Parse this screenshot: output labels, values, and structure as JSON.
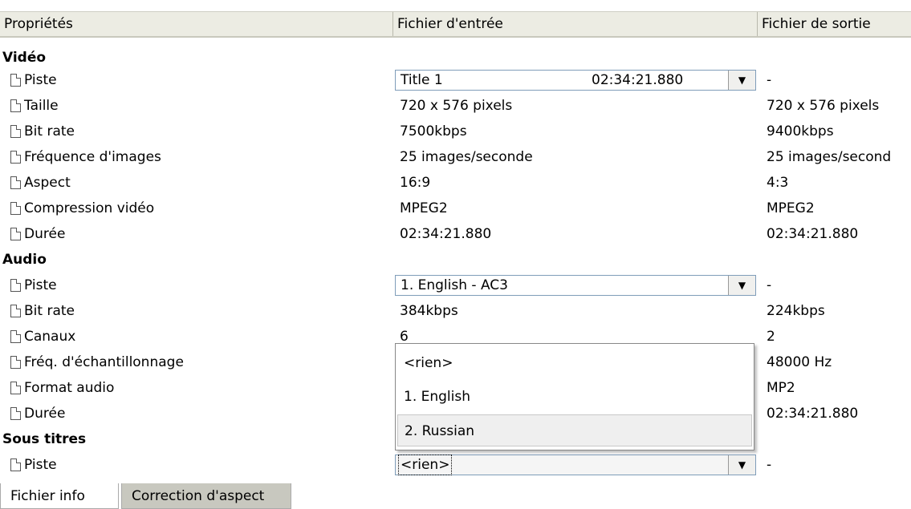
{
  "columns": {
    "properties": "Propriétés",
    "input": "Fichier d'entrée",
    "output": "Fichier de sortie"
  },
  "groups": {
    "video": "Vidéo",
    "audio": "Audio",
    "subtitles": "Sous titres"
  },
  "video_rows": [
    {
      "label": "Piste",
      "input": "Title 1",
      "input_extra": "02:34:21.880",
      "output": "-"
    },
    {
      "label": "Taille",
      "input": "720 x 576 pixels",
      "output": "720 x 576 pixels"
    },
    {
      "label": "Bit rate",
      "input": "7500kbps",
      "output": "9400kbps"
    },
    {
      "label": "Fréquence d'images",
      "input": "25 images/seconde",
      "output": "25 images/second"
    },
    {
      "label": "Aspect",
      "input": "16:9",
      "output": "4:3"
    },
    {
      "label": "Compression vidéo",
      "input": "MPEG2",
      "output": "MPEG2"
    },
    {
      "label": "Durée",
      "input": "02:34:21.880",
      "output": "02:34:21.880"
    }
  ],
  "audio_rows": [
    {
      "label": "Piste",
      "input": "1. English - AC3",
      "output": "-"
    },
    {
      "label": "Bit rate",
      "input": "384kbps",
      "output": "224kbps"
    },
    {
      "label": "Canaux",
      "input": "6",
      "output": "2"
    },
    {
      "label": "Fréq. d'échantillonnage",
      "input": "",
      "output": "48000 Hz"
    },
    {
      "label": "Format audio",
      "input": "",
      "output": "MP2"
    },
    {
      "label": "Durée",
      "input": "",
      "output": "02:34:21.880"
    }
  ],
  "subtitle_rows": [
    {
      "label": "Piste",
      "input": "<rien>",
      "output": "-"
    }
  ],
  "dropdown_options": [
    "<rien>",
    "1. English",
    "2. Russian"
  ],
  "dropdown_selected_index": 2,
  "tabs": [
    "Fichier info",
    "Correction d'aspect"
  ],
  "icons": {
    "row": "document-icon",
    "combo": "dropdown-arrow-icon"
  }
}
